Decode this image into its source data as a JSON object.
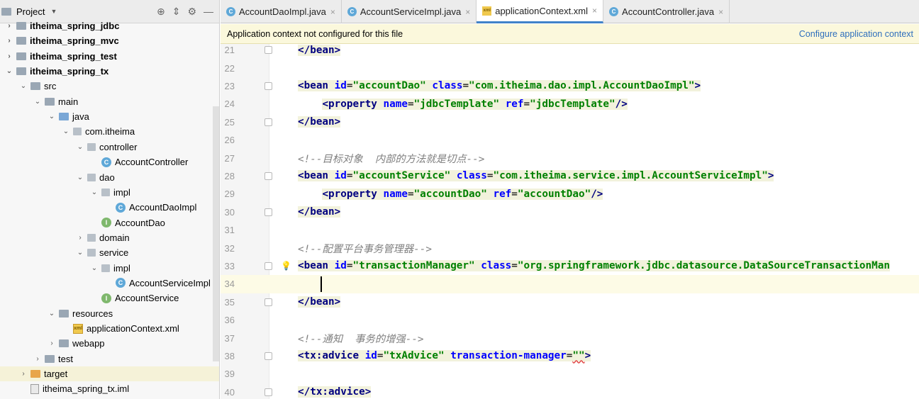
{
  "project_panel": {
    "title": "Project",
    "items": [
      {
        "label": "itheima_spring_jdbc",
        "depth": 0,
        "arrow": "›",
        "icon": "module-folder",
        "bold": true
      },
      {
        "label": "itheima_spring_mvc",
        "depth": 0,
        "arrow": "›",
        "icon": "module-folder",
        "bold": true
      },
      {
        "label": "itheima_spring_test",
        "depth": 0,
        "arrow": "›",
        "icon": "module-folder",
        "bold": true
      },
      {
        "label": "itheima_spring_tx",
        "depth": 0,
        "arrow": "⌄",
        "icon": "module-folder",
        "bold": true
      },
      {
        "label": "src",
        "depth": 1,
        "arrow": "⌄",
        "icon": "folder"
      },
      {
        "label": "main",
        "depth": 2,
        "arrow": "⌄",
        "icon": "folder"
      },
      {
        "label": "java",
        "depth": 3,
        "arrow": "⌄",
        "icon": "source-folder"
      },
      {
        "label": "com.itheima",
        "depth": 4,
        "arrow": "⌄",
        "icon": "package"
      },
      {
        "label": "controller",
        "depth": 5,
        "arrow": "⌄",
        "icon": "package"
      },
      {
        "label": "AccountController",
        "depth": 6,
        "arrow": "",
        "icon": "class"
      },
      {
        "label": "dao",
        "depth": 5,
        "arrow": "⌄",
        "icon": "package"
      },
      {
        "label": "impl",
        "depth": 6,
        "arrow": "⌄",
        "icon": "package"
      },
      {
        "label": "AccountDaoImpl",
        "depth": 7,
        "arrow": "",
        "icon": "class"
      },
      {
        "label": "AccountDao",
        "depth": 6,
        "arrow": "",
        "icon": "interface"
      },
      {
        "label": "domain",
        "depth": 5,
        "arrow": "›",
        "icon": "package"
      },
      {
        "label": "service",
        "depth": 5,
        "arrow": "⌄",
        "icon": "package"
      },
      {
        "label": "impl",
        "depth": 6,
        "arrow": "⌄",
        "icon": "package"
      },
      {
        "label": "AccountServiceImpl",
        "depth": 7,
        "arrow": "",
        "icon": "class"
      },
      {
        "label": "AccountService",
        "depth": 6,
        "arrow": "",
        "icon": "interface"
      },
      {
        "label": "resources",
        "depth": 3,
        "arrow": "⌄",
        "icon": "resources-folder"
      },
      {
        "label": "applicationContext.xml",
        "depth": 4,
        "arrow": "",
        "icon": "xml-file"
      },
      {
        "label": "webapp",
        "depth": 3,
        "arrow": "›",
        "icon": "folder"
      },
      {
        "label": "test",
        "depth": 2,
        "arrow": "›",
        "icon": "folder"
      },
      {
        "label": "target",
        "depth": 1,
        "arrow": "›",
        "icon": "target-folder",
        "selected": true
      },
      {
        "label": "itheima_spring_tx.iml",
        "depth": 1,
        "arrow": "",
        "icon": "iml-file"
      }
    ]
  },
  "tabs": [
    {
      "label": "AccountDaoImpl.java",
      "icon": "class",
      "active": false
    },
    {
      "label": "AccountServiceImpl.java",
      "icon": "class",
      "active": false
    },
    {
      "label": "applicationContext.xml",
      "icon": "xml",
      "active": true
    },
    {
      "label": "AccountController.java",
      "icon": "class",
      "active": false
    }
  ],
  "banner": {
    "message": "Application context not configured for this file",
    "link": "Configure application context"
  },
  "editor": {
    "lines": [
      {
        "num": "21",
        "code": "</bean>"
      },
      {
        "num": "22",
        "code": ""
      },
      {
        "num": "23",
        "code": "<bean id=\"accountDao\" class=\"com.itheima.dao.impl.AccountDaoImpl\">"
      },
      {
        "num": "24",
        "code": "    <property name=\"jdbcTemplate\" ref=\"jdbcTemplate\"/>"
      },
      {
        "num": "25",
        "code": "</bean>"
      },
      {
        "num": "26",
        "code": ""
      },
      {
        "num": "27",
        "code": "<!--目标对象  内部的方法就是切点-->"
      },
      {
        "num": "28",
        "code": "<bean id=\"accountService\" class=\"com.itheima.service.impl.AccountServiceImpl\">"
      },
      {
        "num": "29",
        "code": "    <property name=\"accountDao\" ref=\"accountDao\"/>"
      },
      {
        "num": "30",
        "code": "</bean>"
      },
      {
        "num": "31",
        "code": ""
      },
      {
        "num": "32",
        "code": "<!--配置平台事务管理器-->"
      },
      {
        "num": "33",
        "code": "<bean id=\"transactionManager\" class=\"org.springframework.jdbc.datasource.DataSourceTransactionMan"
      },
      {
        "num": "34",
        "code": ""
      },
      {
        "num": "35",
        "code": "</bean>"
      },
      {
        "num": "36",
        "code": ""
      },
      {
        "num": "37",
        "code": "<!--通知  事务的增强-->"
      },
      {
        "num": "38",
        "code": "<tx:advice id=\"txAdvice\" transaction-manager=\"\">"
      },
      {
        "num": "39",
        "code": ""
      },
      {
        "num": "40",
        "code": "</tx:advice>"
      }
    ]
  }
}
